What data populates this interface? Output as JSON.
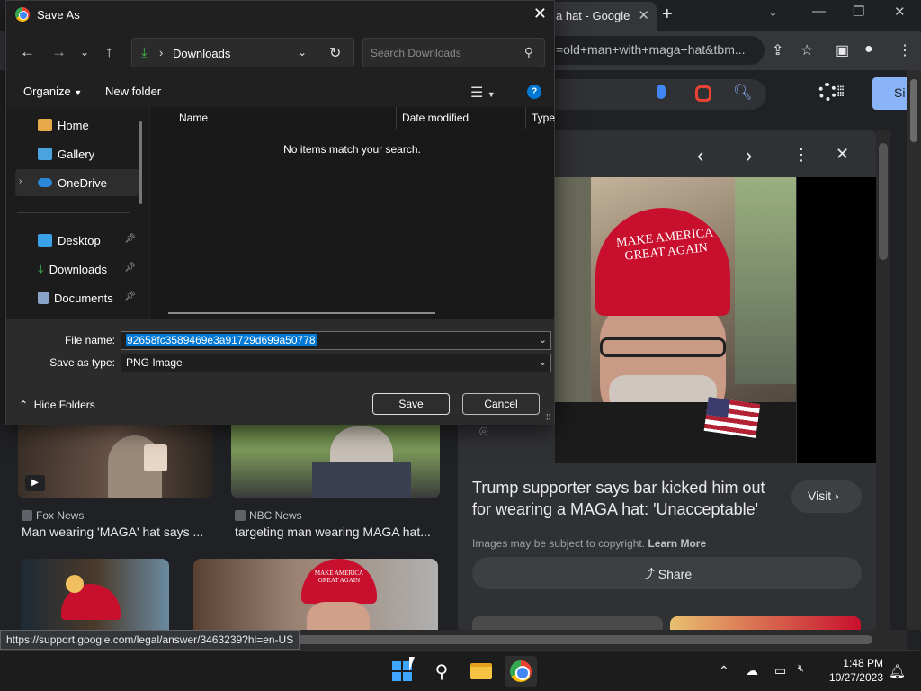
{
  "browser": {
    "tab_title": "a hat - Google",
    "tab_close": "✕",
    "new_tab": "+",
    "omnibox_text": "=old+man+with+maga+hat&tbm...",
    "signin_label": "Si",
    "status_url": "https://support.google.com/legal/answer/3463239?hl=en-US"
  },
  "results": [
    {
      "source": "Fox News",
      "title": "Man wearing 'MAGA' hat says ..."
    },
    {
      "source": "NBC News",
      "title": "targeting man wearing MAGA hat..."
    }
  ],
  "preview": {
    "hat_text": "MAKE AMERICA GREAT AGAIN",
    "title": "Trump supporter says bar kicked him out for wearing a MAGA hat: 'Unacceptable'",
    "visit_label": "Visit",
    "copyright_text": "Images may be subject to copyright.",
    "learn_more": "Learn More",
    "share_label": "Share",
    "thumb_hat_text": "MAKE AMERICA GREAT AGAIN"
  },
  "dialog": {
    "title": "Save As",
    "address": "Downloads",
    "search_placeholder": "Search Downloads",
    "organize_label": "Organize",
    "new_folder_label": "New folder",
    "nav_items": [
      {
        "label": "Home"
      },
      {
        "label": "Gallery"
      },
      {
        "label": "OneDrive"
      },
      {
        "label": "Desktop"
      },
      {
        "label": "Downloads"
      },
      {
        "label": "Documents"
      }
    ],
    "columns": [
      "Name",
      "Date modified",
      "Type"
    ],
    "empty_message": "No items match your search.",
    "file_name_label": "File name:",
    "file_name_value": "92658fc3589469e3a91729d699a50778",
    "save_type_label": "Save as type:",
    "save_type_value": "PNG Image",
    "hide_folders_label": "Hide Folders",
    "save_label": "Save",
    "cancel_label": "Cancel"
  },
  "taskbar": {
    "time": "1:48 PM",
    "date": "10/27/2023"
  },
  "colors": {
    "accent": "#0078d4",
    "maga_red": "#c8102e",
    "dark_bg": "#202124"
  }
}
